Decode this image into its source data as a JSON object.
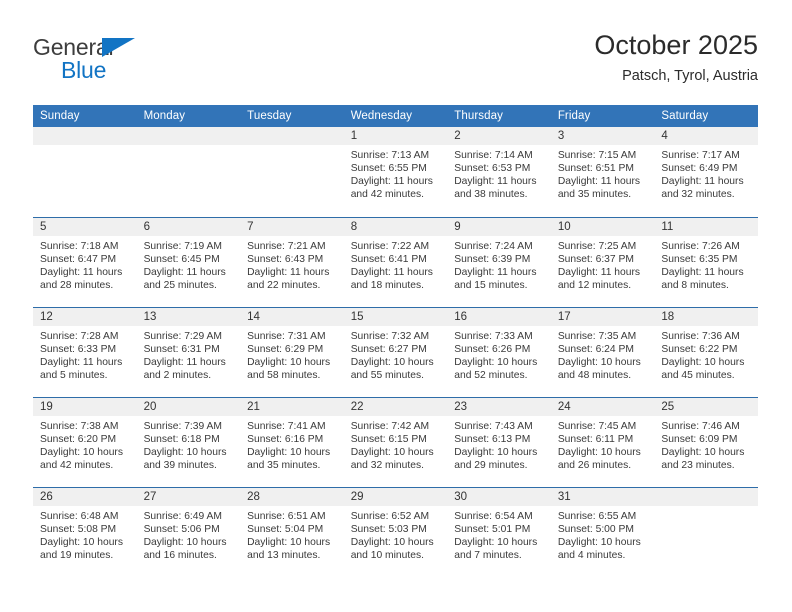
{
  "brand": {
    "line1": "General",
    "line2": "Blue",
    "triangle_color": "#1274c4"
  },
  "header": {
    "title": "October 2025",
    "subtitle": "Patsch, Tyrol, Austria"
  },
  "theme": {
    "header_blue": "#3274b8",
    "week_rule_blue": "#2e6da9",
    "daynum_band": "#f0f0f0",
    "page_background": "#ffffff"
  },
  "columns": [
    "Sunday",
    "Monday",
    "Tuesday",
    "Wednesday",
    "Thursday",
    "Friday",
    "Saturday"
  ],
  "weeks": [
    [
      {
        "day": "",
        "sunrise": "",
        "sunset": "",
        "daylight_1": "",
        "daylight_2": ""
      },
      {
        "day": "",
        "sunrise": "",
        "sunset": "",
        "daylight_1": "",
        "daylight_2": ""
      },
      {
        "day": "",
        "sunrise": "",
        "sunset": "",
        "daylight_1": "",
        "daylight_2": ""
      },
      {
        "day": "1",
        "sunrise": "Sunrise: 7:13 AM",
        "sunset": "Sunset: 6:55 PM",
        "daylight_1": "Daylight: 11 hours",
        "daylight_2": "and 42 minutes."
      },
      {
        "day": "2",
        "sunrise": "Sunrise: 7:14 AM",
        "sunset": "Sunset: 6:53 PM",
        "daylight_1": "Daylight: 11 hours",
        "daylight_2": "and 38 minutes."
      },
      {
        "day": "3",
        "sunrise": "Sunrise: 7:15 AM",
        "sunset": "Sunset: 6:51 PM",
        "daylight_1": "Daylight: 11 hours",
        "daylight_2": "and 35 minutes."
      },
      {
        "day": "4",
        "sunrise": "Sunrise: 7:17 AM",
        "sunset": "Sunset: 6:49 PM",
        "daylight_1": "Daylight: 11 hours",
        "daylight_2": "and 32 minutes."
      }
    ],
    [
      {
        "day": "5",
        "sunrise": "Sunrise: 7:18 AM",
        "sunset": "Sunset: 6:47 PM",
        "daylight_1": "Daylight: 11 hours",
        "daylight_2": "and 28 minutes."
      },
      {
        "day": "6",
        "sunrise": "Sunrise: 7:19 AM",
        "sunset": "Sunset: 6:45 PM",
        "daylight_1": "Daylight: 11 hours",
        "daylight_2": "and 25 minutes."
      },
      {
        "day": "7",
        "sunrise": "Sunrise: 7:21 AM",
        "sunset": "Sunset: 6:43 PM",
        "daylight_1": "Daylight: 11 hours",
        "daylight_2": "and 22 minutes."
      },
      {
        "day": "8",
        "sunrise": "Sunrise: 7:22 AM",
        "sunset": "Sunset: 6:41 PM",
        "daylight_1": "Daylight: 11 hours",
        "daylight_2": "and 18 minutes."
      },
      {
        "day": "9",
        "sunrise": "Sunrise: 7:24 AM",
        "sunset": "Sunset: 6:39 PM",
        "daylight_1": "Daylight: 11 hours",
        "daylight_2": "and 15 minutes."
      },
      {
        "day": "10",
        "sunrise": "Sunrise: 7:25 AM",
        "sunset": "Sunset: 6:37 PM",
        "daylight_1": "Daylight: 11 hours",
        "daylight_2": "and 12 minutes."
      },
      {
        "day": "11",
        "sunrise": "Sunrise: 7:26 AM",
        "sunset": "Sunset: 6:35 PM",
        "daylight_1": "Daylight: 11 hours",
        "daylight_2": "and 8 minutes."
      }
    ],
    [
      {
        "day": "12",
        "sunrise": "Sunrise: 7:28 AM",
        "sunset": "Sunset: 6:33 PM",
        "daylight_1": "Daylight: 11 hours",
        "daylight_2": "and 5 minutes."
      },
      {
        "day": "13",
        "sunrise": "Sunrise: 7:29 AM",
        "sunset": "Sunset: 6:31 PM",
        "daylight_1": "Daylight: 11 hours",
        "daylight_2": "and 2 minutes."
      },
      {
        "day": "14",
        "sunrise": "Sunrise: 7:31 AM",
        "sunset": "Sunset: 6:29 PM",
        "daylight_1": "Daylight: 10 hours",
        "daylight_2": "and 58 minutes."
      },
      {
        "day": "15",
        "sunrise": "Sunrise: 7:32 AM",
        "sunset": "Sunset: 6:27 PM",
        "daylight_1": "Daylight: 10 hours",
        "daylight_2": "and 55 minutes."
      },
      {
        "day": "16",
        "sunrise": "Sunrise: 7:33 AM",
        "sunset": "Sunset: 6:26 PM",
        "daylight_1": "Daylight: 10 hours",
        "daylight_2": "and 52 minutes."
      },
      {
        "day": "17",
        "sunrise": "Sunrise: 7:35 AM",
        "sunset": "Sunset: 6:24 PM",
        "daylight_1": "Daylight: 10 hours",
        "daylight_2": "and 48 minutes."
      },
      {
        "day": "18",
        "sunrise": "Sunrise: 7:36 AM",
        "sunset": "Sunset: 6:22 PM",
        "daylight_1": "Daylight: 10 hours",
        "daylight_2": "and 45 minutes."
      }
    ],
    [
      {
        "day": "19",
        "sunrise": "Sunrise: 7:38 AM",
        "sunset": "Sunset: 6:20 PM",
        "daylight_1": "Daylight: 10 hours",
        "daylight_2": "and 42 minutes."
      },
      {
        "day": "20",
        "sunrise": "Sunrise: 7:39 AM",
        "sunset": "Sunset: 6:18 PM",
        "daylight_1": "Daylight: 10 hours",
        "daylight_2": "and 39 minutes."
      },
      {
        "day": "21",
        "sunrise": "Sunrise: 7:41 AM",
        "sunset": "Sunset: 6:16 PM",
        "daylight_1": "Daylight: 10 hours",
        "daylight_2": "and 35 minutes."
      },
      {
        "day": "22",
        "sunrise": "Sunrise: 7:42 AM",
        "sunset": "Sunset: 6:15 PM",
        "daylight_1": "Daylight: 10 hours",
        "daylight_2": "and 32 minutes."
      },
      {
        "day": "23",
        "sunrise": "Sunrise: 7:43 AM",
        "sunset": "Sunset: 6:13 PM",
        "daylight_1": "Daylight: 10 hours",
        "daylight_2": "and 29 minutes."
      },
      {
        "day": "24",
        "sunrise": "Sunrise: 7:45 AM",
        "sunset": "Sunset: 6:11 PM",
        "daylight_1": "Daylight: 10 hours",
        "daylight_2": "and 26 minutes."
      },
      {
        "day": "25",
        "sunrise": "Sunrise: 7:46 AM",
        "sunset": "Sunset: 6:09 PM",
        "daylight_1": "Daylight: 10 hours",
        "daylight_2": "and 23 minutes."
      }
    ],
    [
      {
        "day": "26",
        "sunrise": "Sunrise: 6:48 AM",
        "sunset": "Sunset: 5:08 PM",
        "daylight_1": "Daylight: 10 hours",
        "daylight_2": "and 19 minutes."
      },
      {
        "day": "27",
        "sunrise": "Sunrise: 6:49 AM",
        "sunset": "Sunset: 5:06 PM",
        "daylight_1": "Daylight: 10 hours",
        "daylight_2": "and 16 minutes."
      },
      {
        "day": "28",
        "sunrise": "Sunrise: 6:51 AM",
        "sunset": "Sunset: 5:04 PM",
        "daylight_1": "Daylight: 10 hours",
        "daylight_2": "and 13 minutes."
      },
      {
        "day": "29",
        "sunrise": "Sunrise: 6:52 AM",
        "sunset": "Sunset: 5:03 PM",
        "daylight_1": "Daylight: 10 hours",
        "daylight_2": "and 10 minutes."
      },
      {
        "day": "30",
        "sunrise": "Sunrise: 6:54 AM",
        "sunset": "Sunset: 5:01 PM",
        "daylight_1": "Daylight: 10 hours",
        "daylight_2": "and 7 minutes."
      },
      {
        "day": "31",
        "sunrise": "Sunrise: 6:55 AM",
        "sunset": "Sunset: 5:00 PM",
        "daylight_1": "Daylight: 10 hours",
        "daylight_2": "and 4 minutes."
      },
      {
        "day": "",
        "sunrise": "",
        "sunset": "",
        "daylight_1": "",
        "daylight_2": ""
      }
    ]
  ]
}
